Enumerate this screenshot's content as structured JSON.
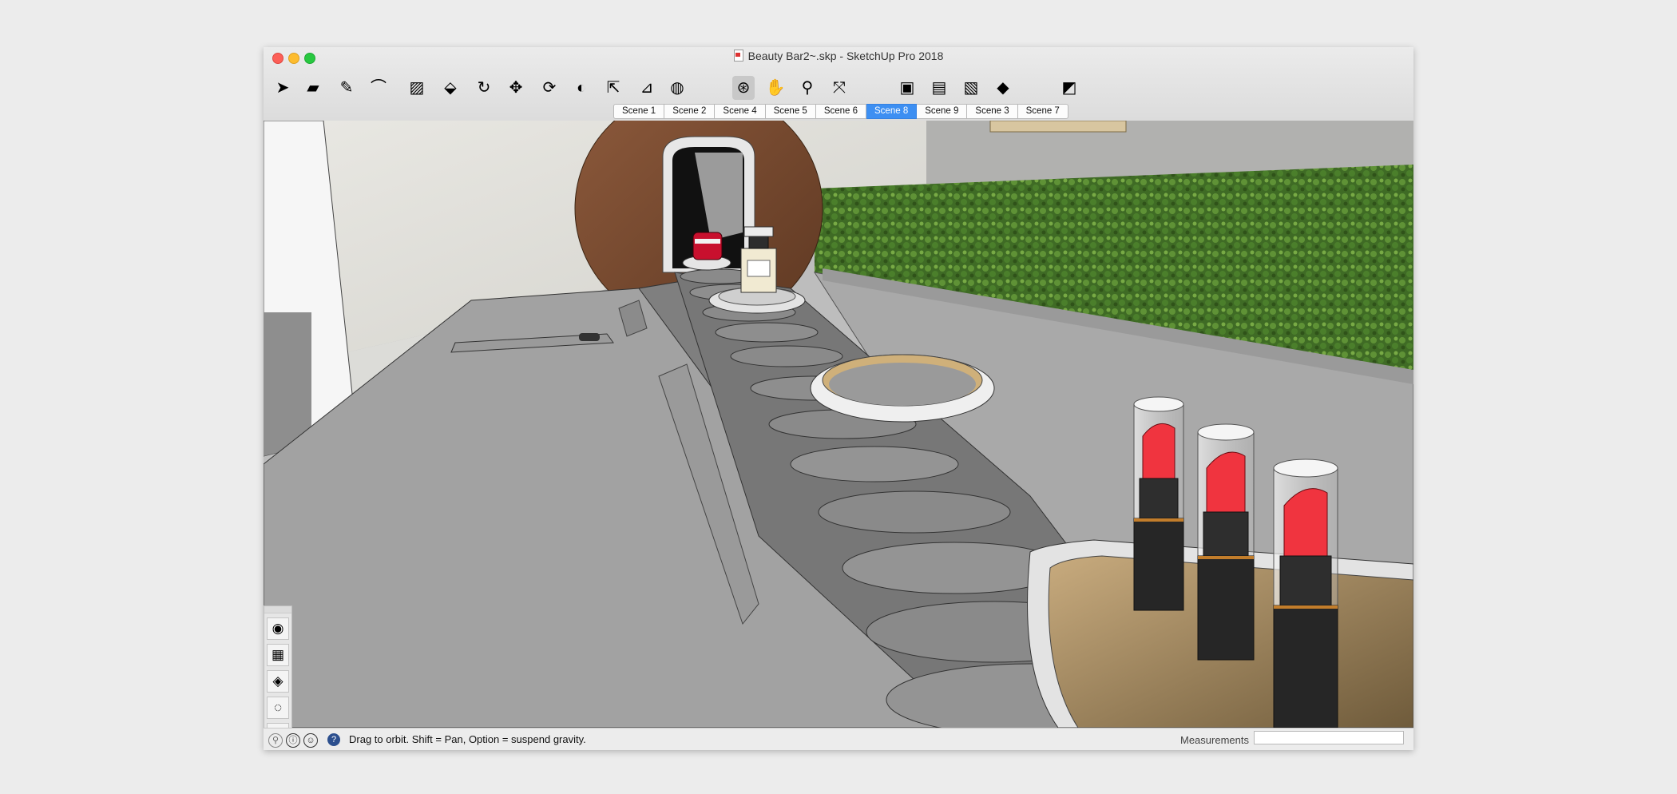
{
  "window": {
    "title": "Beauty Bar2~.skp - SketchUp Pro 2018"
  },
  "toolbar": {
    "tools": [
      {
        "name": "select-tool",
        "glyph": "➤"
      },
      {
        "name": "eraser-tool",
        "glyph": "▰"
      },
      {
        "name": "line-tool",
        "glyph": "✎"
      },
      {
        "name": "arc-tool",
        "glyph": "⌒"
      },
      {
        "name": "shape-tool",
        "glyph": "▨"
      },
      {
        "name": "push-pull-tool",
        "glyph": "⬙"
      },
      {
        "name": "offset-tool",
        "glyph": "↻"
      },
      {
        "name": "move-tool",
        "glyph": "✥"
      },
      {
        "name": "rotate-tool",
        "glyph": "⟳"
      },
      {
        "name": "follow-me-tool",
        "glyph": "◐"
      },
      {
        "name": "scale-tool",
        "glyph": "⇱"
      },
      {
        "name": "tape-measure-tool",
        "glyph": "⊿"
      },
      {
        "name": "paint-bucket-tool",
        "glyph": "◍"
      },
      {
        "name": "orbit-tool",
        "glyph": "⊛"
      },
      {
        "name": "pan-tool",
        "glyph": "✋"
      },
      {
        "name": "zoom-tool",
        "glyph": "⚲"
      },
      {
        "name": "zoom-extents-tool",
        "glyph": "⤧"
      },
      {
        "name": "3d-warehouse-tool",
        "glyph": "▣"
      },
      {
        "name": "extension-warehouse-tool",
        "glyph": "▤"
      },
      {
        "name": "layout-tool",
        "glyph": "▧"
      },
      {
        "name": "extension-manager-tool",
        "glyph": "◆"
      },
      {
        "name": "section-tool",
        "glyph": "◩"
      }
    ]
  },
  "scenes": [
    {
      "label": "Scene 1",
      "active": false
    },
    {
      "label": "Scene 2",
      "active": false
    },
    {
      "label": "Scene 4",
      "active": false
    },
    {
      "label": "Scene 5",
      "active": false
    },
    {
      "label": "Scene 6",
      "active": false
    },
    {
      "label": "Scene 8",
      "active": true
    },
    {
      "label": "Scene 9",
      "active": false
    },
    {
      "label": "Scene 3",
      "active": false
    },
    {
      "label": "Scene 7",
      "active": false
    }
  ],
  "palette": {
    "items": [
      {
        "name": "materials-icon",
        "glyph": "◉"
      },
      {
        "name": "components-icon",
        "glyph": "▦"
      },
      {
        "name": "styles-icon",
        "glyph": "◈"
      },
      {
        "name": "scenes-icon",
        "glyph": "◌"
      },
      {
        "name": "tools-icon",
        "glyph": "⚒"
      },
      {
        "name": "box-icon",
        "glyph": "▩"
      },
      {
        "name": "lightbulb-icon",
        "glyph": "💡"
      }
    ]
  },
  "status": {
    "message": "Drag to orbit. Shift = Pan, Option = suspend gravity.",
    "measurements_label": "Measurements",
    "measurements_value": ""
  },
  "colors": {
    "active_scene": "#3d8ff2",
    "lipstick": "#f0343f",
    "hedge": "#4f7d2f"
  }
}
